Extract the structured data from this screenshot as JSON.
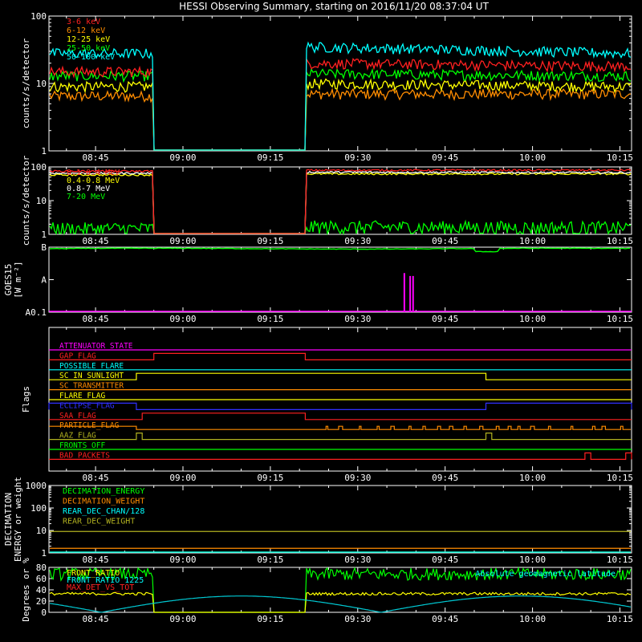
{
  "title": "HESSI Observing Summary, starting on 2016/11/20 08:37:04 UT",
  "colors": {
    "background": "#000000",
    "axes": "#ffffff",
    "red": "#ff2020",
    "orange": "#ff8c00",
    "yellow": "#ffff00",
    "green": "#00ff00",
    "cyan": "#00ffff",
    "magenta": "#ff00ff",
    "blue": "#3030ff",
    "olive": "#b0b020"
  },
  "time_axis": {
    "start": "08:37",
    "end": "10:17",
    "tick_labels": [
      "08:45",
      "09:00",
      "09:15",
      "09:30",
      "09:45",
      "10:00",
      "10:15"
    ],
    "gap": [
      "08:55",
      "09:21"
    ]
  },
  "chart_data": [
    {
      "id": "lo",
      "type": "line",
      "ylabel": "counts/s/detector",
      "yscale": "log",
      "ylim": [
        1,
        100
      ],
      "ytick_labels": [
        "1",
        "10",
        "100"
      ],
      "legend_placement": "top-left",
      "series": [
        {
          "name": "3-6 keV",
          "color": "#ff2020",
          "level_before": 15,
          "level_after": 20,
          "end": 18
        },
        {
          "name": "6-12 keV",
          "color": "#ff8c00",
          "level_before": 6.5,
          "level_after": 7,
          "end": 7
        },
        {
          "name": "12-25 keV",
          "color": "#ffff00",
          "level_before": 9,
          "level_after": 10,
          "end": 9
        },
        {
          "name": "25-50 keV",
          "color": "#00ff00",
          "level_before": 13,
          "level_after": 14,
          "end": 13
        },
        {
          "name": "50-100 keV",
          "color": "#00ffff",
          "level_before": 28,
          "level_after": 35,
          "end": 28
        }
      ]
    },
    {
      "id": "hi",
      "type": "line",
      "ylabel": "counts/s/detector",
      "yscale": "log",
      "ylim": [
        1,
        100
      ],
      "ytick_labels": [
        "1",
        "10",
        "100"
      ],
      "legend_placement": "top-left",
      "series": [
        {
          "name": "0.1-0.4 MeV",
          "color": "#ff2020",
          "level_before": 75,
          "level_after": 80,
          "end": 80
        },
        {
          "name": "0.4-0.8 MeV",
          "color": "#ffff00",
          "level_before": 58,
          "level_after": 62,
          "end": 62
        },
        {
          "name": "0.8-7 MeV",
          "color": "#ffffff",
          "level_before": 65,
          "level_after": 70,
          "end": 68
        },
        {
          "name": "7-20 MeV",
          "color": "#00ff00",
          "level_before": 1.5,
          "level_after": 1.7,
          "end": 1.6
        }
      ]
    },
    {
      "id": "goes",
      "type": "line",
      "ylabel": "GOES15",
      "ylabel2": "[W m⁻²]",
      "ytick_labels": [
        "A0.1",
        "A",
        "B"
      ],
      "ylim_class": [
        -8,
        -7
      ],
      "series": [
        {
          "name": "GOES15 1-8 Å",
          "color": "#00ff00",
          "level": 9e-08
        }
      ],
      "spikes": [
        {
          "time": "09:38",
          "level": 1.6e-08,
          "color": "#ff00ff"
        },
        {
          "time": "09:39",
          "level": 1.3e-08,
          "color": "#ff00ff"
        },
        {
          "time": "09:39:30",
          "level": 1.3e-08,
          "color": "#ff00ff"
        }
      ]
    },
    {
      "id": "flags",
      "type": "line",
      "ylabel": "Flags",
      "flags": [
        {
          "name": "ATTENUATOR_STATE",
          "color": "#ff00ff",
          "on": []
        },
        {
          "name": "GAP_FLAG",
          "color": "#ff2020",
          "on": [
            [
              "08:55",
              "09:21"
            ]
          ]
        },
        {
          "name": "POSSIBLE_FLARE",
          "color": "#00ffff",
          "on": []
        },
        {
          "name": "SC_IN_SUNLIGHT",
          "color": "#ffff00",
          "on": [
            [
              "08:52",
              "09:52"
            ]
          ]
        },
        {
          "name": "SC_TRANSMITTER",
          "color": "#ff8c00",
          "on": []
        },
        {
          "name": "FLARE_FLAG",
          "color": "#ffff00",
          "on": []
        },
        {
          "name": "ECLIPSE_FLAG",
          "color": "#3030ff",
          "on": [
            [
              "08:37",
              "08:52"
            ],
            [
              "09:52",
              "10:17"
            ]
          ]
        },
        {
          "name": "SAA_FLAG",
          "color": "#ff2020",
          "on": [
            [
              "08:53",
              "09:21"
            ]
          ]
        },
        {
          "name": "PARTICLE_FLAG",
          "color": "#ff8c00",
          "on": [
            [
              "08:37",
              "08:52"
            ]
          ]
        },
        {
          "name": "AAZ_FLAG",
          "color": "#b0b020",
          "on": [
            [
              "08:52",
              "08:53"
            ],
            [
              "09:52",
              "09:53"
            ]
          ]
        },
        {
          "name": "FRONTS_OFF",
          "color": "#00ff00",
          "on": []
        },
        {
          "name": "BAD_PACKETS",
          "color": "#ff2020",
          "on": [
            [
              "10:09",
              "10:10"
            ],
            [
              "10:16",
              "10:17"
            ]
          ]
        }
      ]
    },
    {
      "id": "dec",
      "type": "line",
      "ylabel": "DECIMATION",
      "ylabel2": "ENERGY or weight",
      "yscale": "log",
      "ylim": [
        1,
        1000
      ],
      "ytick_labels": [
        "1",
        "10",
        "100",
        "1000"
      ],
      "legend_placement": "top-left",
      "series": [
        {
          "name": "DECIMATION_ENERGY",
          "color": "#00ff00",
          "level": 1
        },
        {
          "name": "DECIMATION_WEIGHT",
          "color": "#ff8c00",
          "level": 1.6
        },
        {
          "name": "REAR_DEC_CHAN/128",
          "color": "#00ffff",
          "level": 1
        },
        {
          "name": "REAR_DEC_WEIGHT",
          "color": "#b0b020",
          "level": 9
        }
      ]
    },
    {
      "id": "ratio",
      "type": "line",
      "ylabel": "Degrees or %",
      "ylim": [
        0,
        80
      ],
      "ytick_labels": [
        "0",
        "20",
        "40",
        "60",
        "80"
      ],
      "legend_placement": "top-left",
      "annotation": "Absolute geomagnetic latitude",
      "series": [
        {
          "name": "FRONT_RATIO",
          "color": "#ffff00",
          "level": 33
        },
        {
          "name": "FRONT_RATIO_1225",
          "color": "#00ffff",
          "level": 0
        },
        {
          "name": "MAX_DET_VS_TOT",
          "color": "#ff2020",
          "level": 0
        },
        {
          "name": "Absolute geomagnetic latitude",
          "color": "#00c8d2",
          "level": 0
        }
      ],
      "green_noise": {
        "level": 68
      }
    }
  ]
}
